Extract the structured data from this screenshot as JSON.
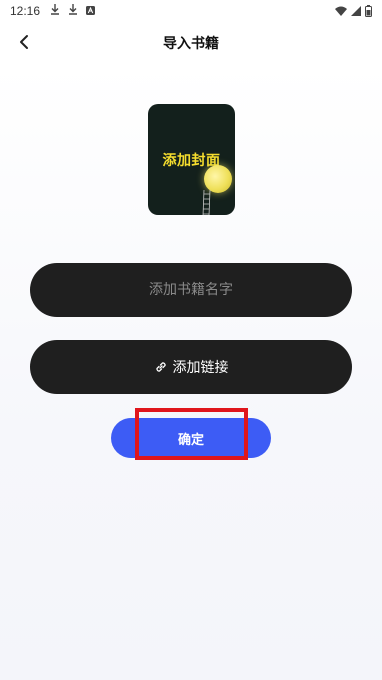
{
  "status_bar": {
    "time": "12:16",
    "icons": [
      "download-icon",
      "download-icon",
      "font-icon",
      "wifi-icon",
      "signal-icon",
      "battery-icon"
    ]
  },
  "header": {
    "title": "导入书籍",
    "back_icon": "chevron-left-icon"
  },
  "cover": {
    "label": "添加封面"
  },
  "name_field": {
    "value": "",
    "placeholder": "添加书籍名字"
  },
  "link_button": {
    "label": "添加链接",
    "icon": "link-icon"
  },
  "confirm_button": {
    "label": "确定"
  },
  "colors": {
    "accent": "#3d5cf5",
    "field_bg": "#1f1f1f",
    "highlight": "#e0161c",
    "cover_text": "#f5dd2e"
  }
}
